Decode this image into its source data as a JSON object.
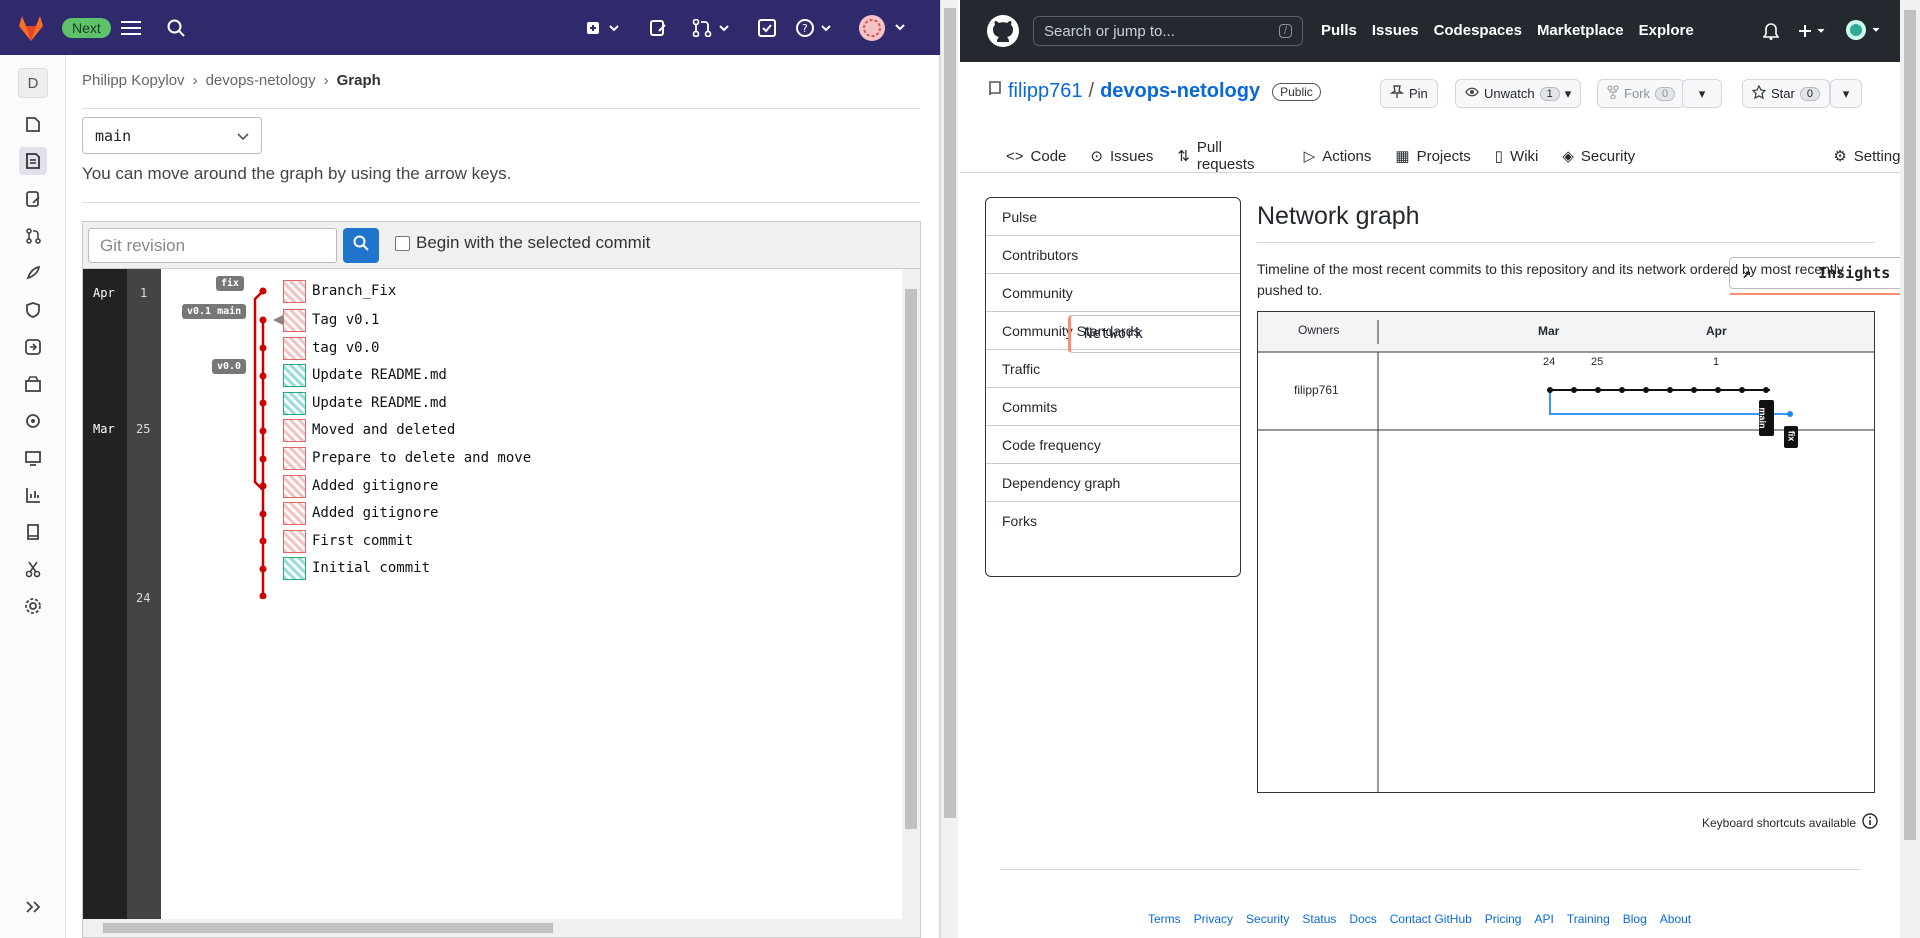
{
  "gitlab": {
    "next_badge": "Next",
    "project_avatar_letter": "D",
    "breadcrumb": [
      "Philipp Kopylov",
      "devops-netology",
      "Graph"
    ],
    "branch_select": "main",
    "hint": "You can move around the graph by using the arrow keys.",
    "revision_placeholder": "Git revision",
    "begin_label": "Begin with the selected commit",
    "months": [
      {
        "label": "Apr"
      },
      {
        "label": "Mar"
      }
    ],
    "days": [
      {
        "label": "1"
      },
      {
        "label": "25"
      },
      {
        "label": "24"
      }
    ],
    "commits": [
      {
        "msg": "Branch_Fix",
        "tag": "fix"
      },
      {
        "msg": "Tag v0.1",
        "tag": "v0.1 main"
      },
      {
        "msg": "tag v0.0",
        "tag": ""
      },
      {
        "msg": "Update README.md",
        "tag": "v0.0"
      },
      {
        "msg": "Update README.md",
        "tag": ""
      },
      {
        "msg": "Moved and deleted",
        "tag": ""
      },
      {
        "msg": "Prepare to delete and move",
        "tag": ""
      },
      {
        "msg": "Added gitignore",
        "tag": ""
      },
      {
        "msg": "Added gitignore",
        "tag": ""
      },
      {
        "msg": "First commit",
        "tag": ""
      },
      {
        "msg": "Initial commit",
        "tag": ""
      }
    ]
  },
  "github": {
    "search_placeholder": "Search or jump to...",
    "search_key": "/",
    "nav": [
      "Pulls",
      "Issues",
      "Codespaces",
      "Marketplace",
      "Explore"
    ],
    "owner": "filipp761",
    "repo": "devops-netology",
    "visibility": "Public",
    "pin": "Pin",
    "unwatch": "Unwatch",
    "unwatch_count": "1",
    "fork": "Fork",
    "fork_count": "0",
    "star": "Star",
    "star_count": "0",
    "tabs": [
      "Code",
      "Issues",
      "Pull requests",
      "Actions",
      "Projects",
      "Wiki",
      "Security",
      "Insights",
      "Settings"
    ],
    "menu": [
      "Pulse",
      "Contributors",
      "Community",
      "Community Standards",
      "Traffic",
      "Commits",
      "Code frequency",
      "Dependency graph",
      "Network",
      "Forks"
    ],
    "heading": "Network graph",
    "description": "Timeline of the most recent commits to this repository and its network ordered by most recently pushed to.",
    "network": {
      "owners_header": "Owners",
      "months": [
        "Mar",
        "Apr"
      ],
      "days": [
        "24",
        "25",
        "1"
      ],
      "owner_row": "filipp761",
      "branch_labels": [
        "main",
        "fix"
      ]
    },
    "keyboard": "Keyboard shortcuts available",
    "footer": [
      "Terms",
      "Privacy",
      "Security",
      "Status",
      "Docs",
      "Contact GitHub",
      "Pricing",
      "API",
      "Training",
      "Blog",
      "About"
    ]
  }
}
